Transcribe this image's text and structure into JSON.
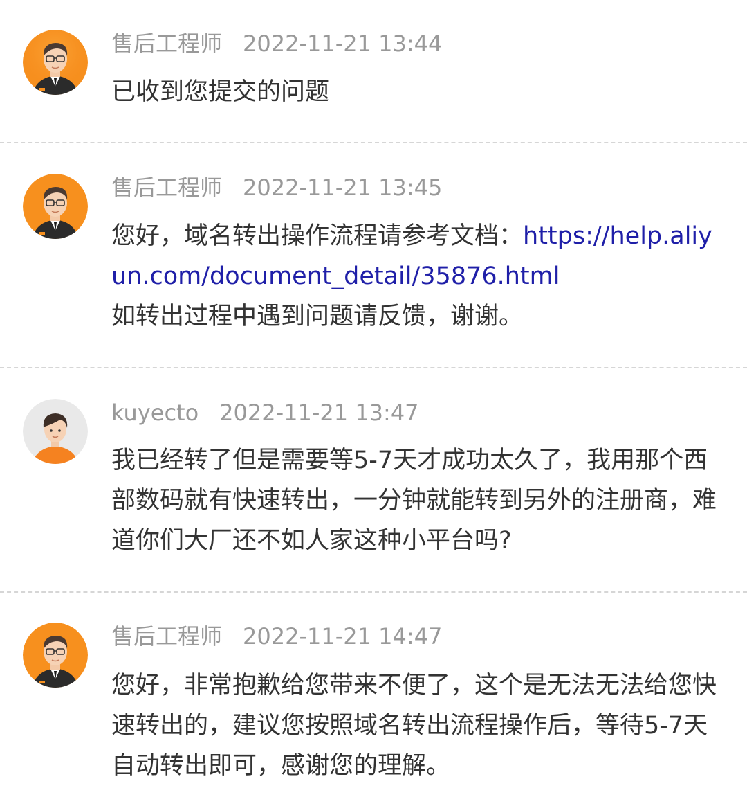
{
  "messages": [
    {
      "author": "售后工程师",
      "time": "2022-11-21 13:44",
      "avatar_icon": "engineer-avatar-icon",
      "lines": [
        "已收到您提交的问题"
      ]
    },
    {
      "author": "售后工程师",
      "time": "2022-11-21 13:45",
      "avatar_icon": "engineer-avatar-icon",
      "text_before_link": "您好，域名转出操作流程请参考文档：",
      "link_text": "https://help.aliyun.com/document_detail/35876.html",
      "text_after_link": "如转出过程中遇到问题请反馈，谢谢。"
    },
    {
      "author": "kuyecto",
      "time": "2022-11-21 13:47",
      "avatar_icon": "user-avatar-icon",
      "lines": [
        "我已经转了但是需要等5-7天才成功太久了，我用那个西部数码就有快速转出，一分钟就能转到另外的注册商，难道你们大厂还不如人家这种小平台吗?"
      ]
    },
    {
      "author": "售后工程师",
      "time": "2022-11-21 14:47",
      "avatar_icon": "engineer-avatar-icon",
      "lines": [
        "您好，非常抱歉给您带来不便了，这个是无法无法给您快速转出的，建议您按照域名转出流程操作后，等待5-7天自动转出即可，感谢您的理解。"
      ]
    }
  ],
  "colors": {
    "engineer_avatar_bg": "#f7901e",
    "user_avatar_bg": "#e9e9e9",
    "meta_text": "#999999",
    "body_text": "#333333",
    "link": "#1f1fa8",
    "divider": "#d6d6d6"
  }
}
